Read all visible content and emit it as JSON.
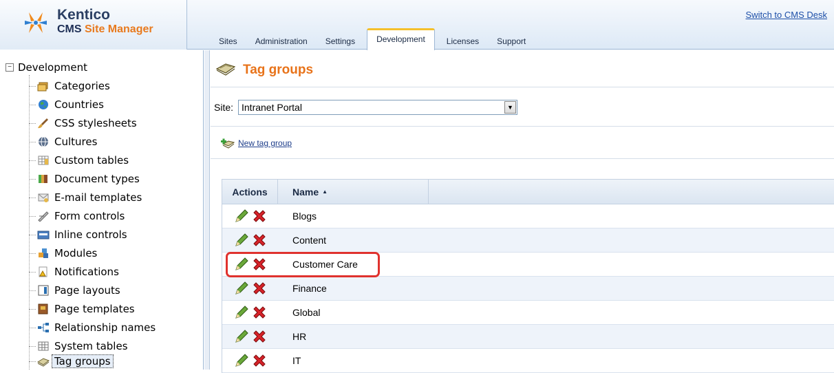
{
  "header": {
    "logo_line1": "Kentico",
    "logo_line2_part1": "CMS ",
    "logo_line2_part2": "Site Manager",
    "switch_link": "Switch to CMS Desk",
    "tabs": [
      {
        "label": "Sites",
        "active": false
      },
      {
        "label": "Administration",
        "active": false
      },
      {
        "label": "Settings",
        "active": false
      },
      {
        "label": "Development",
        "active": true
      },
      {
        "label": "Licenses",
        "active": false
      },
      {
        "label": "Support",
        "active": false
      }
    ]
  },
  "sidebar": {
    "root": {
      "label": "Development",
      "toggle": "−"
    },
    "items": [
      {
        "label": "Categories",
        "icon": "categories-icon"
      },
      {
        "label": "Countries",
        "icon": "globe-icon"
      },
      {
        "label": "CSS stylesheets",
        "icon": "brush-icon"
      },
      {
        "label": "Cultures",
        "icon": "culture-globe-icon"
      },
      {
        "label": "Custom tables",
        "icon": "table-icon"
      },
      {
        "label": "Document types",
        "icon": "document-types-icon"
      },
      {
        "label": "E-mail templates",
        "icon": "email-template-icon"
      },
      {
        "label": "Form controls",
        "icon": "form-controls-icon"
      },
      {
        "label": "Inline controls",
        "icon": "inline-controls-icon"
      },
      {
        "label": "Modules",
        "icon": "modules-icon"
      },
      {
        "label": "Notifications",
        "icon": "notification-icon"
      },
      {
        "label": "Page layouts",
        "icon": "page-layout-icon"
      },
      {
        "label": "Page templates",
        "icon": "page-template-icon"
      },
      {
        "label": "Relationship names",
        "icon": "relationship-icon"
      },
      {
        "label": "System tables",
        "icon": "system-table-icon"
      },
      {
        "label": "Tag groups",
        "icon": "tag-groups-icon",
        "selected": true
      }
    ]
  },
  "main": {
    "title": "Tag groups",
    "site_label": "Site:",
    "site_value": "Intranet Portal",
    "new_tag_group": "New tag group",
    "grid": {
      "columns": {
        "actions": "Actions",
        "name": "Name"
      },
      "sort_indicator": "▲",
      "rows": [
        {
          "name": "Blogs"
        },
        {
          "name": "Content"
        },
        {
          "name": "Customer Care",
          "highlighted": true
        },
        {
          "name": "Finance"
        },
        {
          "name": "Global"
        },
        {
          "name": "HR"
        },
        {
          "name": "IT"
        }
      ]
    }
  },
  "colors": {
    "title_orange": "#e8731a",
    "highlight_red": "#e0322e",
    "tab_accent": "#f5c02b",
    "link_blue": "#1d4fa8"
  }
}
